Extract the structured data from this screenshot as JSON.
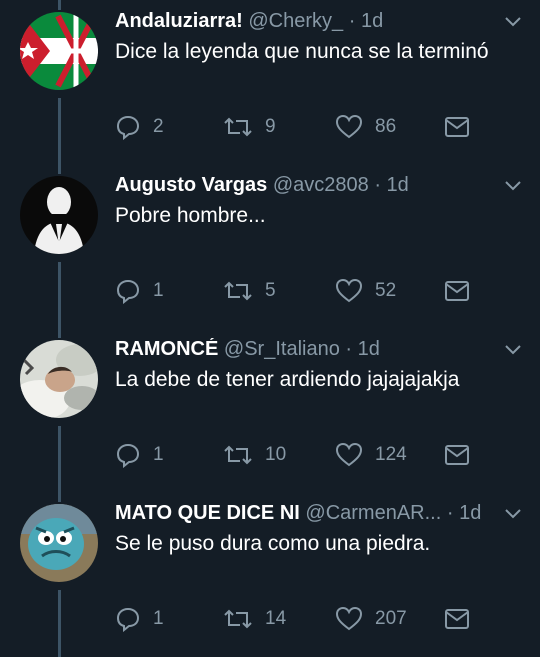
{
  "colors": {
    "background": "#141d26",
    "muted": "#8899a6",
    "thread_line": "#3d5466"
  },
  "tweets": [
    {
      "name": "Andaluziarra!",
      "handle": "@Cherky_",
      "separator": "·",
      "time": "1d",
      "text": "Dice la leyenda que nunca se la terminó",
      "replies": "2",
      "retweets": "9",
      "likes": "86",
      "avatar_icon": "flag-avatar"
    },
    {
      "name": "Augusto Vargas",
      "handle": "@avc2808",
      "separator": "·",
      "time": "1d",
      "text": "Pobre hombre...",
      "replies": "1",
      "retweets": "5",
      "likes": "52",
      "avatar_icon": "anonymous-suit-avatar"
    },
    {
      "name": "RAMONCÉ",
      "handle": "@Sr_Italiano",
      "separator": "·",
      "time": "1d",
      "text": "La debe de tener ardiendo jajajajakja",
      "replies": "1",
      "retweets": "10",
      "likes": "124",
      "avatar_icon": "person-lying-avatar"
    },
    {
      "name": "MATO QUE DICE NI",
      "handle": "@CarmenAR...",
      "separator": "·",
      "time": "1d",
      "text": "Se le puso dura como una piedra.",
      "replies": "1",
      "retweets": "14",
      "likes": "207",
      "avatar_icon": "cartoon-character-avatar"
    }
  ]
}
